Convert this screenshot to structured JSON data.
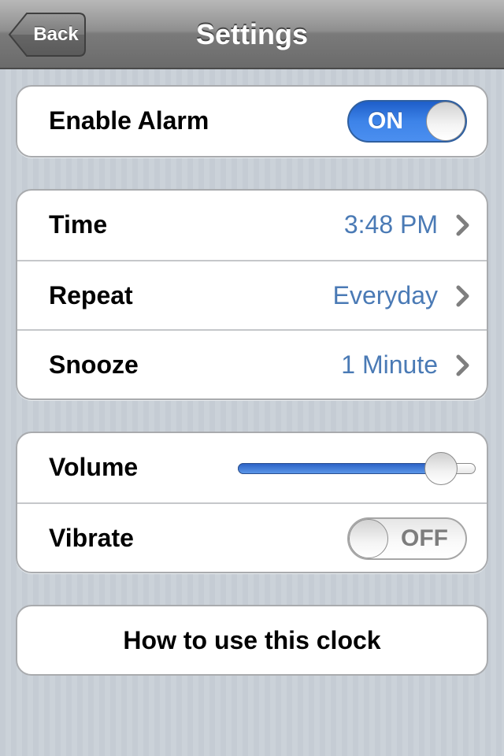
{
  "navbar": {
    "title": "Settings",
    "back_label": "Back"
  },
  "alarm": {
    "label": "Enable Alarm",
    "toggle_text": "ON",
    "state": "on"
  },
  "schedule": {
    "items": [
      {
        "label": "Time",
        "value": "3:48 PM"
      },
      {
        "label": "Repeat",
        "value": "Everyday"
      },
      {
        "label": "Snooze",
        "value": "1 Minute"
      }
    ]
  },
  "sound": {
    "volume_label": "Volume",
    "volume_level": 0.91,
    "vibrate_label": "Vibrate",
    "vibrate_toggle_text": "OFF",
    "vibrate_state": "off"
  },
  "help": {
    "label": "How to use this clock"
  },
  "icons": {
    "back": "back-arrow-icon",
    "disclosure": "chevron-right-icon"
  },
  "colors": {
    "value_text": "#4a7ab5",
    "toggle_on": "#3d83e8",
    "background": "#c5ccd4"
  }
}
